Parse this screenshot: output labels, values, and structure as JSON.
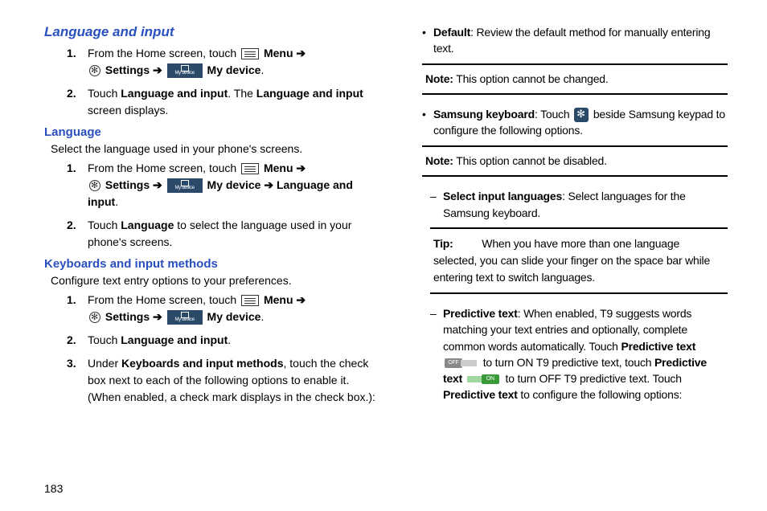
{
  "page_number": "183",
  "left": {
    "heading": "Language and input",
    "list1": {
      "1a": "From the Home screen, touch ",
      "1b": " Menu ",
      "1c": " Settings ",
      "1d": " My device",
      "1e": ".",
      "2a": "Touch ",
      "2b": "Language and input",
      "2c": ". The ",
      "2d": "Language and input",
      "2e": " screen displays."
    },
    "sub1": "Language",
    "intro1": "Select the language used in your phone's screens.",
    "list2": {
      "1a": "From the Home screen, touch ",
      "1b": " Menu ",
      "1c": " Settings ",
      "1d": " My device ",
      "1e": " Language and input",
      "1f": ".",
      "2a": "Touch ",
      "2b": "Language",
      "2c": " to select the language used in your phone's screens."
    },
    "sub2": "Keyboards and input methods",
    "intro2": "Configure text entry options to your preferences.",
    "list3": {
      "1a": "From the Home screen, touch ",
      "1b": " Menu ",
      "1c": " Settings ",
      "1d": " My device",
      "1e": ".",
      "2a": "Touch ",
      "2b": "Language and input",
      "2c": ".",
      "3a": "Under ",
      "3b": "Keyboards and input methods",
      "3c": ", touch the check box next to each of the following options to enable it. (When enabled, a check mark displays in the check box.):"
    }
  },
  "right": {
    "default_b": "Default",
    "default_t": ": Review the default method for manually entering text.",
    "note1_b": "Note:",
    "note1_t": " This option cannot be changed.",
    "samsung_b": "Samsung keyboard",
    "samsung_t1": ": Touch ",
    "samsung_t2": " beside Samsung keypad to configure the following options.",
    "note2_b": "Note:",
    "note2_t": " This option cannot be disabled.",
    "sel_b": "Select input languages",
    "sel_t": ": Select languages for the Samsung keyboard.",
    "tip_b": "Tip:",
    "tip_t": " When you have more than one language selected, you can slide your finger on the space bar while entering text to switch languages.",
    "pred_b1": "Predictive text",
    "pred_t1": ": When enabled, T9 suggests words matching your text entries and optionally, complete common words automatically. Touch ",
    "pred_b2": "Predictive text",
    "pred_t2": " to turn ON T9 predictive text, touch ",
    "pred_b3": "Predictive text",
    "pred_t3": " to turn OFF T9 predictive text. Touch ",
    "pred_b4": "Predictive text",
    "pred_t4": " to configure the following options:",
    "off_label": "OFF",
    "on_label": "ON"
  }
}
